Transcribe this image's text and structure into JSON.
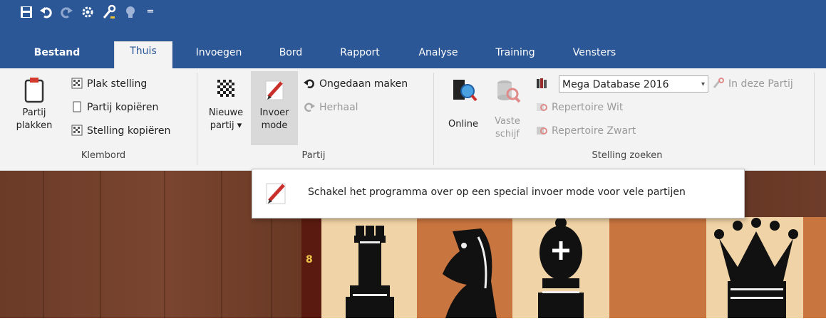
{
  "quick_access": {
    "icons": [
      "save-icon",
      "undo-icon",
      "redo-icon",
      "engine-icon",
      "tools-icon",
      "bulb-icon",
      "customize-icon"
    ],
    "customize_symbol": "="
  },
  "tabs": [
    {
      "label": "Bestand",
      "active": false
    },
    {
      "label": "Thuis",
      "active": true
    },
    {
      "label": "Invoegen",
      "active": false
    },
    {
      "label": "Bord",
      "active": false
    },
    {
      "label": "Rapport",
      "active": false
    },
    {
      "label": "Analyse",
      "active": false
    },
    {
      "label": "Training",
      "active": false
    },
    {
      "label": "Vensters",
      "active": false
    }
  ],
  "clipboard": {
    "group": "Klembord",
    "paste_game_line1": "Partij",
    "paste_game_line2": "plakken",
    "paste_position": "Plak stelling",
    "copy_game": "Partij kopiëren",
    "copy_position": "Stelling kopiëren"
  },
  "game": {
    "group": "Partij",
    "new_game_line1": "Nieuwe",
    "new_game_line2": "partij",
    "dropdown_arrow": "▾",
    "input_mode_line1": "Invoer",
    "input_mode_line2": "mode",
    "undo": "Ongedaan maken",
    "redo": "Herhaal"
  },
  "search": {
    "group": "Stelling zoeken",
    "online": "Online",
    "hard_disk_line1": "Vaste",
    "hard_disk_line2": "schijf",
    "database_value": "Mega Database 2016",
    "in_this_game": "In deze Partij",
    "repertoire_white": "Repertoire Wit",
    "repertoire_black": "Repertoire Zwart"
  },
  "tooltip": {
    "text": "Schakel het programma over op een special invoer mode voor vele partijen"
  },
  "board": {
    "rank_label": "8"
  },
  "colors": {
    "accent": "#2b5797",
    "ribbon": "#f3f3f3",
    "light_square": "#f0d3a6",
    "dark_square": "#c8753f",
    "rank_border": "#5a1a10"
  }
}
